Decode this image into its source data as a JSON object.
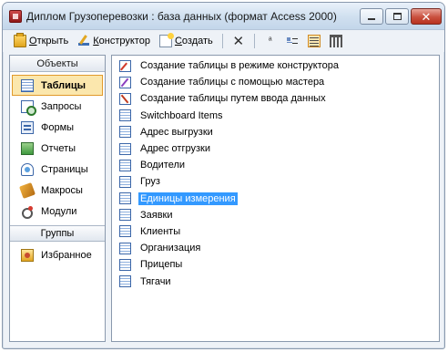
{
  "window": {
    "title": "Диплом Грузоперевозки : база данных (формат Access 2000)",
    "icon": "access-database-icon"
  },
  "toolbar": {
    "open_label": "Открыть",
    "open_mnemonic": "О",
    "design_label": "Конструктор",
    "design_mnemonic": "К",
    "new_label": "Создать",
    "new_mnemonic": "С"
  },
  "sidebar": {
    "header": "Объекты",
    "items": [
      {
        "label": "Таблицы",
        "icon": "table-icon",
        "active": true
      },
      {
        "label": "Запросы",
        "icon": "query-icon",
        "active": false
      },
      {
        "label": "Формы",
        "icon": "form-icon",
        "active": false
      },
      {
        "label": "Отчеты",
        "icon": "report-icon",
        "active": false
      },
      {
        "label": "Страницы",
        "icon": "page-icon",
        "active": false
      },
      {
        "label": "Макросы",
        "icon": "macro-icon",
        "active": false
      },
      {
        "label": "Модули",
        "icon": "module-icon",
        "active": false
      }
    ],
    "groups_header": "Группы",
    "groups": [
      {
        "label": "Избранное",
        "icon": "favorites-icon"
      }
    ]
  },
  "main": {
    "items": [
      {
        "label": "Создание таблицы в режиме конструктора",
        "icon": "design-shortcut-icon",
        "selected": false
      },
      {
        "label": "Создание таблицы с помощью мастера",
        "icon": "wizard-shortcut-icon",
        "selected": false
      },
      {
        "label": "Создание таблицы путем ввода данных",
        "icon": "entry-shortcut-icon",
        "selected": false
      },
      {
        "label": "Switchboard Items",
        "icon": "table-icon",
        "selected": false
      },
      {
        "label": "Адрес выгрузки",
        "icon": "table-icon",
        "selected": false
      },
      {
        "label": "Адрес отгрузки",
        "icon": "table-icon",
        "selected": false
      },
      {
        "label": "Водители",
        "icon": "table-icon",
        "selected": false
      },
      {
        "label": "Груз",
        "icon": "table-icon",
        "selected": false
      },
      {
        "label": "Единицы измерения",
        "icon": "table-icon",
        "selected": true
      },
      {
        "label": "Заявки",
        "icon": "table-icon",
        "selected": false
      },
      {
        "label": "Клиенты",
        "icon": "table-icon",
        "selected": false
      },
      {
        "label": "Организация",
        "icon": "table-icon",
        "selected": false
      },
      {
        "label": "Прицепы",
        "icon": "table-icon",
        "selected": false
      },
      {
        "label": "Тягачи",
        "icon": "table-icon",
        "selected": false
      }
    ]
  },
  "colors": {
    "selection_bg": "#3399ff",
    "active_sidebar_bg": "#fbe7ad",
    "active_sidebar_border": "#e19a2b"
  }
}
